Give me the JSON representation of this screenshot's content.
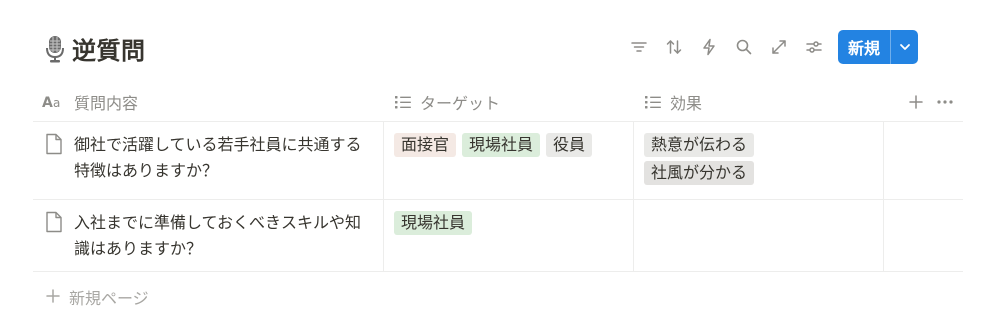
{
  "header": {
    "title": "逆質問",
    "title_icon": "microphone-icon",
    "new_button": "新規"
  },
  "toolbar_icons": [
    "filter-icon",
    "sort-icon",
    "automation-icon",
    "search-icon",
    "expand-icon",
    "settings-icon"
  ],
  "columns": {
    "name": "質問内容",
    "target": "ターゲット",
    "effect": "効果"
  },
  "rows": [
    {
      "name": "御社で活躍している若手社員に共通する特徴はありますか？",
      "targets": [
        {
          "label": "面接官",
          "color": "#f4e9e4"
        },
        {
          "label": "現場社員",
          "color": "#dbeddb"
        },
        {
          "label": "役員",
          "color": "#e9e9e7"
        }
      ],
      "effects": [
        {
          "label": "熱意が伝わる",
          "color": "#e9e9e7"
        },
        {
          "label": "社風が分かる",
          "color": "#e3e2e0"
        }
      ]
    },
    {
      "name": "入社までに準備しておくべきスキルや知識はありますか？",
      "targets": [
        {
          "label": "現場社員",
          "color": "#dbeddb"
        }
      ],
      "effects": []
    }
  ],
  "footer": {
    "new_page": "新規ページ"
  },
  "colors": {
    "accent": "#2383e2",
    "text": "#37352f",
    "muted": "#8d8c88"
  }
}
